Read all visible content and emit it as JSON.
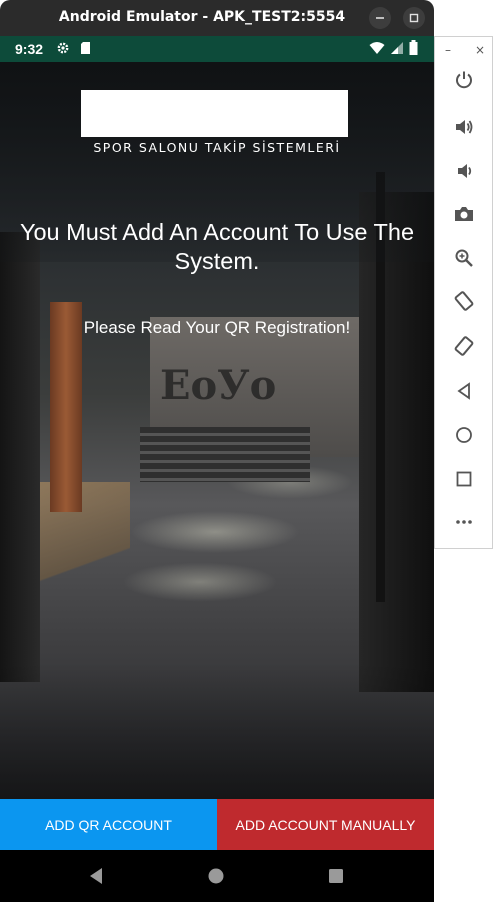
{
  "window": {
    "title": "Android Emulator - APK_TEST2:5554",
    "minimize_icon": "minimize-icon",
    "maximize_icon": "maximize-icon"
  },
  "status_bar": {
    "time": "9:32",
    "left_icons": [
      "settings-gear-icon",
      "sd-card-icon"
    ],
    "right_icons": [
      "wifi-icon",
      "signal-icon",
      "battery-icon"
    ],
    "background": "#0d4b3a"
  },
  "app": {
    "subtitle": "SPOR SALONU TAKİP SİSTEMLERİ",
    "heading": "You Must Add An Account To Use The System.",
    "instruction": "Please Read Your QR Registration!",
    "buttons": {
      "qr_label": "ADD QR ACCOUNT",
      "manual_label": "ADD ACCOUNT MANUALLY"
    },
    "colors": {
      "qr_button": "#0b96f0",
      "manual_button": "#bf2a2e"
    }
  },
  "nav_bar": {
    "items": [
      "back-icon",
      "home-icon",
      "recents-icon"
    ]
  },
  "side_panel": {
    "window_controls": [
      "–",
      "×"
    ],
    "tools": [
      "power-icon",
      "volume-up-icon",
      "volume-down-icon",
      "camera-icon",
      "zoom-icon",
      "rotate-left-icon",
      "rotate-right-icon",
      "back-icon",
      "home-icon",
      "overview-icon",
      "more-icon"
    ]
  }
}
